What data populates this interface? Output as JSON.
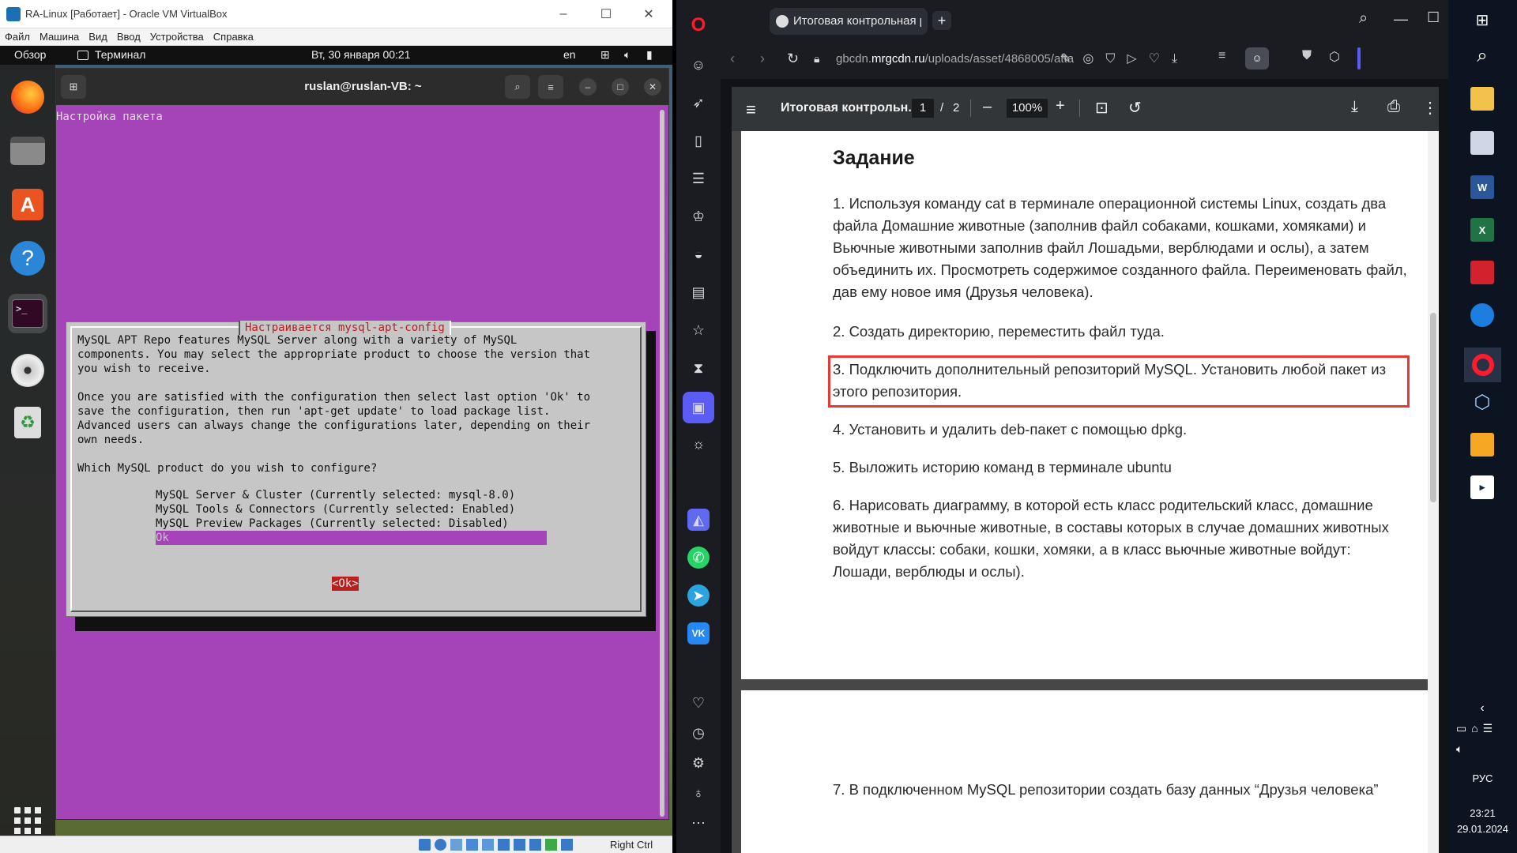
{
  "vbox": {
    "title": "RA-Linux [Работает] - Oracle VM VirtualBox",
    "menu": [
      "Файл",
      "Машина",
      "Вид",
      "Ввод",
      "Устройства",
      "Справка"
    ],
    "statusbar_right": "Right Ctrl"
  },
  "ubuntu": {
    "activities": "Обзор",
    "app_name": "Терминал",
    "datetime": "Вт, 30 января  00:21",
    "lang": "en"
  },
  "terminal": {
    "title": "ruslan@ruslan-VB: ~",
    "pkg_header": "Настройка пакета",
    "dialog_title": "Настраивается mysql-apt-config",
    "dialog_text": "MySQL APT Repo features MySQL Server along with a variety of MySQL\ncomponents. You may select the appropriate product to choose the version that\nyou wish to receive.\n\nOnce you are satisfied with the configuration then select last option 'Ok' to\nsave the configuration, then run 'apt-get update' to load package list.\nAdvanced users can always change the configurations later, depending on their\nown needs.\n\nWhich MySQL product do you wish to configure?",
    "options": [
      "MySQL Server & Cluster (Currently selected: mysql-8.0)",
      "MySQL Tools & Connectors (Currently selected: Enabled)",
      "MySQL Preview Packages (Currently selected: Disabled)",
      "Ok"
    ],
    "ok_button": "<Ok>"
  },
  "browser": {
    "tab_title": "Итоговая контрольная р",
    "url_prefix": "gbcdn.",
    "url_domain": "mrgcdn.ru",
    "url_rest": "/uploads/asset/4868005/atta",
    "pdf_title": "Итоговая контрольн...",
    "page_current": "1",
    "page_sep": "/",
    "page_total": "2",
    "zoom": "100%"
  },
  "document": {
    "heading": "Задание",
    "items": [
      "1. Используя команду cat в терминале операционной системы Linux, создать два файла Домашние животные (заполнив файл собаками, кошками, хомяками) и Вьючные животными заполнив файл Лошадьми, верблюдами и ослы), а затем объединить их. Просмотреть содержимое созданного файла. Переименовать файл, дав ему новое имя (Друзья человека).",
      "2. Создать директорию, переместить файл туда.",
      "3. Подключить дополнительный репозиторий MySQL. Установить любой пакет из этого репозитория.",
      "4. Установить и удалить deb-пакет с помощью dpkg.",
      "5. Выложить историю команд в терминале ubuntu",
      "6. Нарисовать диаграмму, в которой есть класс родительский класс, домашние животные и вьючные животные, в составы которых в случае домашних животных войдут классы: собаки, кошки, хомяки, а в класс вьючные животные войдут: Лошади, верблюды и ослы).",
      "7. В подключенном MySQL репозитории создать базу данных “Друзья человека”"
    ]
  },
  "windows": {
    "lang": "РУС",
    "time": "23:21",
    "date": "29.01.2024"
  }
}
